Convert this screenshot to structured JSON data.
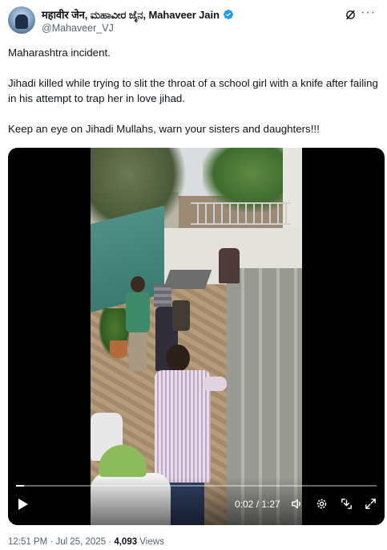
{
  "author": {
    "display_name": "महावीर जेन, ಮಹಾವೀರ ಜೈನ, Mahaveer Jain",
    "handle": "@Mahaveer_VJ",
    "verified": true,
    "verified_color": "#1d9bf0"
  },
  "header_icons": {
    "grok": "grok-icon",
    "more": "more-icon",
    "more_glyph": "···"
  },
  "tweet": {
    "line1": "Maharashtra incident.",
    "line2": "Jihadi killed while trying to slit the throat of a school girl with a knife after failing in his attempt to trap her in love jihad.",
    "line3": "Keep an eye on Jihadi Mullahs, warn your sisters and daughters!!!"
  },
  "video": {
    "current_time": "0:02",
    "duration": "1:27",
    "time_display": "0:02 / 1:27",
    "progress_fraction": 0.023,
    "icons": [
      "play-icon",
      "volume-icon",
      "settings-icon",
      "download-icon",
      "fullscreen-icon"
    ]
  },
  "meta": {
    "timestamp": "12:51 PM · Jul 25, 2025 · ",
    "views_count": "4,093",
    "views_label": " Views"
  },
  "colors": {
    "text_primary": "#0f1419",
    "text_secondary": "#536471",
    "verified_badge": "#1d9bf0"
  }
}
